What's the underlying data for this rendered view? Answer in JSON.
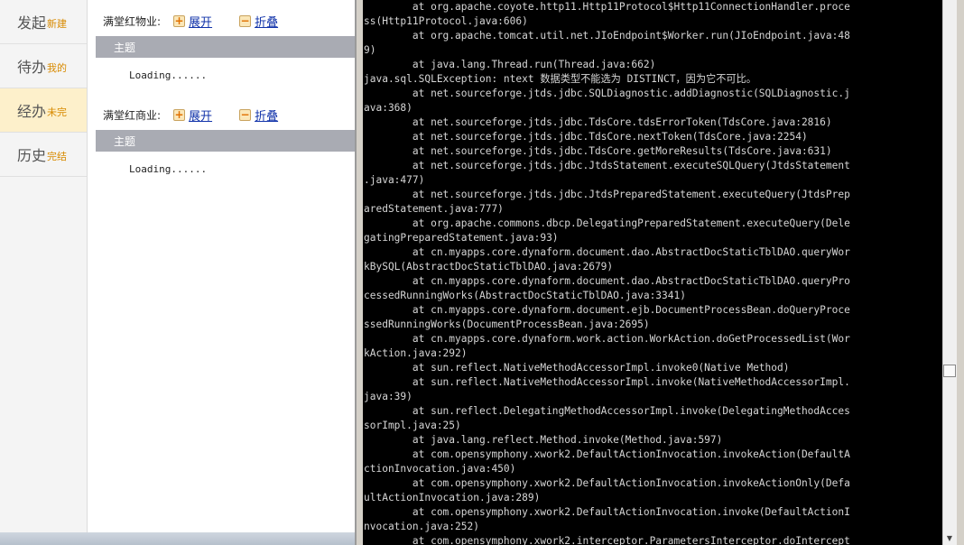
{
  "sidebar": {
    "items": [
      {
        "main": "发起",
        "sub": "新建",
        "active": false
      },
      {
        "main": "待办",
        "sub": "我的",
        "active": false
      },
      {
        "main": "经办",
        "sub": "未完",
        "active": true
      },
      {
        "main": "历史",
        "sub": "完结",
        "active": false
      }
    ]
  },
  "groups": [
    {
      "label": "满堂红物业:",
      "expand": "展开",
      "collapse": "折叠",
      "subject": "主题",
      "loading": "Loading......"
    },
    {
      "label": "满堂红商业:",
      "expand": "展开",
      "collapse": "折叠",
      "subject": "主题",
      "loading": "Loading......"
    }
  ],
  "console": {
    "lines": [
      "        at org.apache.coyote.http11.Http11Protocol$Http11ConnectionHandler.proce",
      "ss(Http11Protocol.java:606)",
      "        at org.apache.tomcat.util.net.JIoEndpoint$Worker.run(JIoEndpoint.java:48",
      "9)",
      "        at java.lang.Thread.run(Thread.java:662)",
      "java.sql.SQLException: ntext 数据类型不能选为 DISTINCT，因为它不可比。",
      "        at net.sourceforge.jtds.jdbc.SQLDiagnostic.addDiagnostic(SQLDiagnostic.j",
      "ava:368)",
      "        at net.sourceforge.jtds.jdbc.TdsCore.tdsErrorToken(TdsCore.java:2816)",
      "        at net.sourceforge.jtds.jdbc.TdsCore.nextToken(TdsCore.java:2254)",
      "        at net.sourceforge.jtds.jdbc.TdsCore.getMoreResults(TdsCore.java:631)",
      "        at net.sourceforge.jtds.jdbc.JtdsStatement.executeSQLQuery(JtdsStatement",
      ".java:477)",
      "        at net.sourceforge.jtds.jdbc.JtdsPreparedStatement.executeQuery(JtdsPrep",
      "aredStatement.java:777)",
      "        at org.apache.commons.dbcp.DelegatingPreparedStatement.executeQuery(Dele",
      "gatingPreparedStatement.java:93)",
      "        at cn.myapps.core.dynaform.document.dao.AbstractDocStaticTblDAO.queryWor",
      "kBySQL(AbstractDocStaticTblDAO.java:2679)",
      "        at cn.myapps.core.dynaform.document.dao.AbstractDocStaticTblDAO.queryPro",
      "cessedRunningWorks(AbstractDocStaticTblDAO.java:3341)",
      "        at cn.myapps.core.dynaform.document.ejb.DocumentProcessBean.doQueryProce",
      "ssedRunningWorks(DocumentProcessBean.java:2695)",
      "        at cn.myapps.core.dynaform.work.action.WorkAction.doGetProcessedList(Wor",
      "kAction.java:292)",
      "        at sun.reflect.NativeMethodAccessorImpl.invoke0(Native Method)",
      "        at sun.reflect.NativeMethodAccessorImpl.invoke(NativeMethodAccessorImpl.",
      "java:39)",
      "        at sun.reflect.DelegatingMethodAccessorImpl.invoke(DelegatingMethodAcces",
      "sorImpl.java:25)",
      "        at java.lang.reflect.Method.invoke(Method.java:597)",
      "        at com.opensymphony.xwork2.DefaultActionInvocation.invokeAction(DefaultA",
      "ctionInvocation.java:450)",
      "        at com.opensymphony.xwork2.DefaultActionInvocation.invokeActionOnly(Defa",
      "ultActionInvocation.java:289)",
      "        at com.opensymphony.xwork2.DefaultActionInvocation.invoke(DefaultActionI",
      "nvocation.java:252)",
      "        at com.opensymphony.xwork2.interceptor.ParametersInterceptor.doIntercept"
    ]
  }
}
